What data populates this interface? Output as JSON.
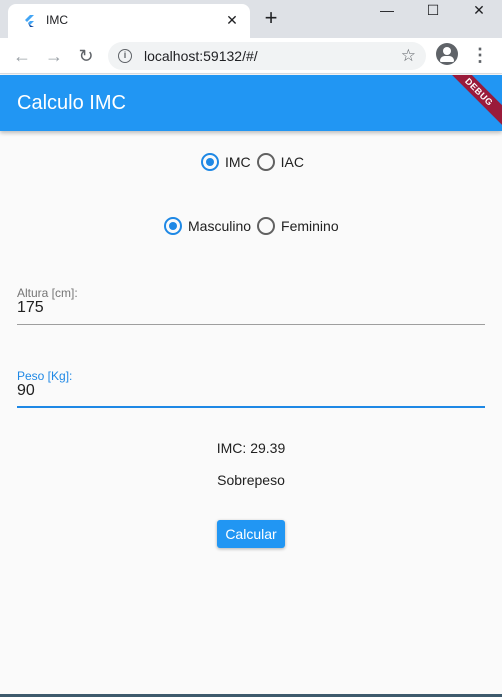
{
  "browser": {
    "tab_title": "IMC",
    "tab_close": "✕",
    "new_tab": "+",
    "window_controls": {
      "minimize": "—",
      "maximize": "☐",
      "close": "✕"
    },
    "back": "←",
    "forward": "→",
    "reload": "↻",
    "url": "localhost:59132/#/",
    "star": "☆",
    "menu": "⋮"
  },
  "app": {
    "title": "Calculo IMC",
    "debug_banner": "DEBUG",
    "accent_color": "#2196f3",
    "mode_options": [
      {
        "label": "IMC",
        "selected": true
      },
      {
        "label": "IAC",
        "selected": false
      }
    ],
    "sex_options": [
      {
        "label": "Masculino",
        "selected": true
      },
      {
        "label": "Feminino",
        "selected": false
      }
    ],
    "height_field": {
      "label": "Altura [cm]:",
      "value": "175"
    },
    "weight_field": {
      "label": "Peso [Kg]:",
      "value": "90"
    },
    "result_value": "IMC: 29.39",
    "result_category": "Sobrepeso",
    "calculate_label": "Calcular"
  }
}
